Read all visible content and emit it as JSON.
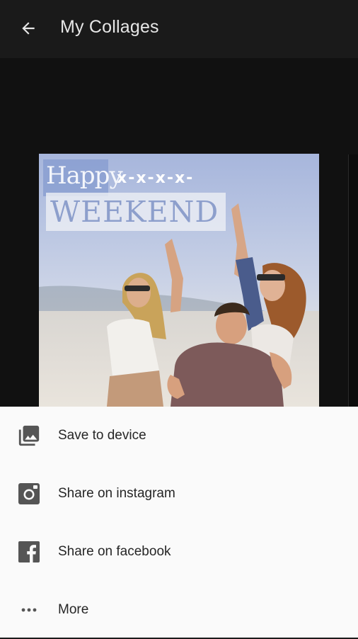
{
  "header": {
    "title": "My Collages"
  },
  "collage": {
    "line1": "Happy",
    "line1_decoration": "x-x-x-x-",
    "line2": "WEEKEND"
  },
  "share_sheet": {
    "items": [
      {
        "label": "Save to device",
        "icon": "gallery-icon"
      },
      {
        "label": "Share on instagram",
        "icon": "instagram-icon"
      },
      {
        "label": "Share on facebook",
        "icon": "facebook-icon"
      },
      {
        "label": "More",
        "icon": "more-dots-icon"
      }
    ]
  },
  "colors": {
    "app_bar": "#1a1a1a",
    "sheet_background": "#fafafa",
    "icon_gray": "#555555"
  }
}
